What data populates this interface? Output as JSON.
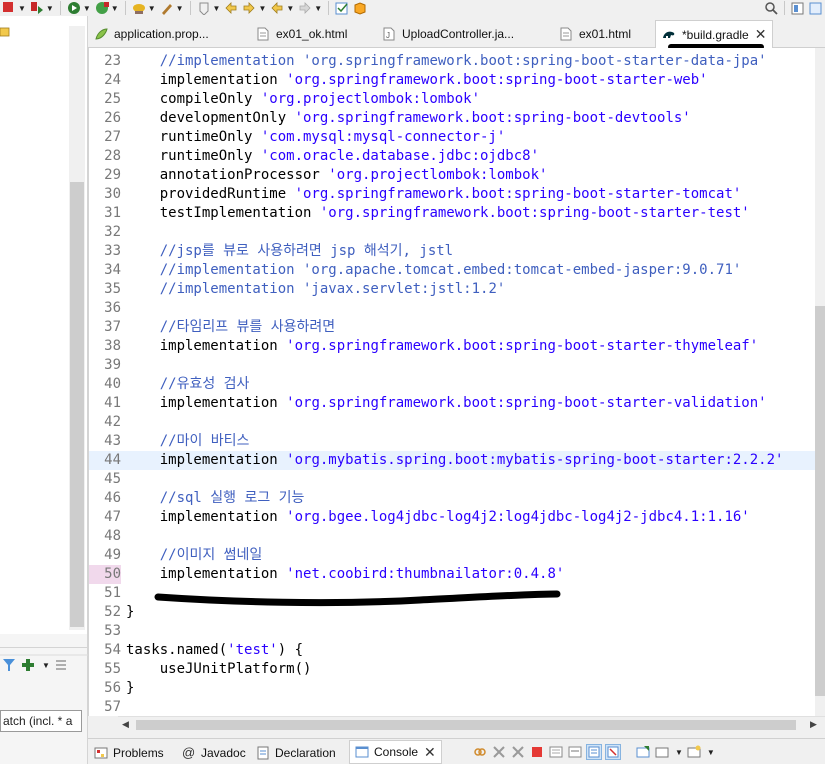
{
  "toolbar": {
    "icons": [
      "stop-icon",
      "debug-run-icon",
      "run-icon",
      "external-tools-icon",
      "search-file-icon",
      "navigate-back-icon",
      "navigate-forward-icon",
      "search-icon",
      "perspective-icon"
    ]
  },
  "left_panel": {
    "filter_input": {
      "value": "atch (incl. * a"
    }
  },
  "tabs": [
    {
      "label": "application.prop...",
      "icon": "properties-file-icon",
      "active": false
    },
    {
      "label": "ex01_ok.html",
      "icon": "html-file-icon",
      "active": false
    },
    {
      "label": "UploadController.ja...",
      "icon": "java-file-icon",
      "active": false
    },
    {
      "label": "ex01.html",
      "icon": "html-file-icon",
      "active": false
    },
    {
      "label": "*build.gradle",
      "icon": "gradle-file-icon",
      "active": true
    }
  ],
  "editor": {
    "lines": [
      {
        "n": "23",
        "parts": [
          [
            "    ",
            "kw"
          ],
          [
            "//implementation 'org.springframework.boot:spring-boot-starter-data-jpa'",
            "cm"
          ]
        ]
      },
      {
        "n": "24",
        "parts": [
          [
            "    implementation ",
            "kw"
          ],
          [
            "'org.springframework.boot:spring-boot-starter-web'",
            "str"
          ]
        ]
      },
      {
        "n": "25",
        "parts": [
          [
            "    compileOnly ",
            "kw"
          ],
          [
            "'org.projectlombok:lombok'",
            "str"
          ]
        ]
      },
      {
        "n": "26",
        "parts": [
          [
            "    developmentOnly ",
            "kw"
          ],
          [
            "'org.springframework.boot:spring-boot-devtools'",
            "str"
          ]
        ]
      },
      {
        "n": "27",
        "parts": [
          [
            "    runtimeOnly ",
            "kw"
          ],
          [
            "'com.mysql:mysql-connector-j'",
            "str"
          ]
        ]
      },
      {
        "n": "28",
        "parts": [
          [
            "    runtimeOnly ",
            "kw"
          ],
          [
            "'com.oracle.database.jdbc:ojdbc8'",
            "str"
          ]
        ]
      },
      {
        "n": "29",
        "parts": [
          [
            "    annotationProcessor ",
            "kw"
          ],
          [
            "'org.projectlombok:lombok'",
            "str"
          ]
        ]
      },
      {
        "n": "30",
        "parts": [
          [
            "    providedRuntime ",
            "kw"
          ],
          [
            "'org.springframework.boot:spring-boot-starter-tomcat'",
            "str"
          ]
        ]
      },
      {
        "n": "31",
        "parts": [
          [
            "    testImplementation ",
            "kw"
          ],
          [
            "'org.springframework.boot:spring-boot-starter-test'",
            "str"
          ]
        ]
      },
      {
        "n": "32",
        "parts": []
      },
      {
        "n": "33",
        "parts": [
          [
            "    ",
            "kw"
          ],
          [
            "//jsp를 뷰로 사용하려면 jsp 해석기, jstl",
            "cm"
          ]
        ]
      },
      {
        "n": "34",
        "parts": [
          [
            "    ",
            "kw"
          ],
          [
            "//implementation 'org.apache.tomcat.embed:tomcat-embed-jasper:9.0.71'",
            "cm"
          ]
        ]
      },
      {
        "n": "35",
        "parts": [
          [
            "    ",
            "kw"
          ],
          [
            "//implementation 'javax.servlet:jstl:1.2'",
            "cm"
          ]
        ]
      },
      {
        "n": "36",
        "parts": []
      },
      {
        "n": "37",
        "parts": [
          [
            "    ",
            "kw"
          ],
          [
            "//타임리프 뷰를 사용하려면",
            "cm"
          ]
        ]
      },
      {
        "n": "38",
        "parts": [
          [
            "    implementation ",
            "kw"
          ],
          [
            "'org.springframework.boot:spring-boot-starter-thymeleaf'",
            "str"
          ]
        ]
      },
      {
        "n": "39",
        "parts": []
      },
      {
        "n": "40",
        "parts": [
          [
            "    ",
            "kw"
          ],
          [
            "//유효성 검사",
            "cm"
          ]
        ]
      },
      {
        "n": "41",
        "parts": [
          [
            "    implementation ",
            "kw"
          ],
          [
            "'org.springframework.boot:spring-boot-starter-validation'",
            "str"
          ]
        ]
      },
      {
        "n": "42",
        "parts": []
      },
      {
        "n": "43",
        "parts": [
          [
            "    ",
            "kw"
          ],
          [
            "//마이 바티스",
            "cm"
          ]
        ]
      },
      {
        "n": "44",
        "parts": [
          [
            "    implementation ",
            "kw"
          ],
          [
            "'org.mybatis.spring.boot:mybatis-spring-boot-starter:2.2.2'",
            "str"
          ]
        ],
        "highlight": true
      },
      {
        "n": "45",
        "parts": []
      },
      {
        "n": "46",
        "parts": [
          [
            "    ",
            "kw"
          ],
          [
            "//sql 실행 로그 기능",
            "cm"
          ]
        ]
      },
      {
        "n": "47",
        "parts": [
          [
            "    implementation ",
            "kw"
          ],
          [
            "'org.bgee.log4jdbc-log4j2:log4jdbc-log4j2-jdbc4.1:1.16'",
            "str"
          ]
        ]
      },
      {
        "n": "48",
        "parts": []
      },
      {
        "n": "49",
        "parts": [
          [
            "    ",
            "kw"
          ],
          [
            "//이미지 썸네일",
            "cm"
          ]
        ]
      },
      {
        "n": "50",
        "parts": [
          [
            "    implementation ",
            "kw"
          ],
          [
            "'net.coobird:thumbnailator:0.4.8'",
            "str"
          ]
        ],
        "marked": true
      },
      {
        "n": "51",
        "parts": []
      },
      {
        "n": "52",
        "parts": [
          [
            "}",
            "kw"
          ]
        ]
      },
      {
        "n": "53",
        "parts": []
      },
      {
        "n": "54",
        "parts": [
          [
            "tasks.named(",
            "kw"
          ],
          [
            "'test'",
            "str"
          ],
          [
            ") {",
            "kw"
          ]
        ]
      },
      {
        "n": "55",
        "parts": [
          [
            "    useJUnitPlatform()",
            "kw"
          ]
        ]
      },
      {
        "n": "56",
        "parts": [
          [
            "}",
            "kw"
          ]
        ]
      },
      {
        "n": "57",
        "parts": []
      }
    ]
  },
  "bottom_tabs": [
    {
      "label": "Problems",
      "icon": "problems-icon",
      "active": false
    },
    {
      "label": "Javadoc",
      "icon": "javadoc-icon",
      "active": false
    },
    {
      "label": "Declaration",
      "icon": "declaration-icon",
      "active": false
    },
    {
      "label": "Console",
      "icon": "console-icon",
      "active": true
    }
  ],
  "console_toolbar_icons": [
    "link-icon",
    "remove-all-icon",
    "remove-launch-icon",
    "terminate-icon",
    "clear-console-icon",
    "scroll-lock-icon",
    "word-wrap-icon",
    "pin-console-icon",
    "display-console-icon",
    "open-console-icon"
  ]
}
